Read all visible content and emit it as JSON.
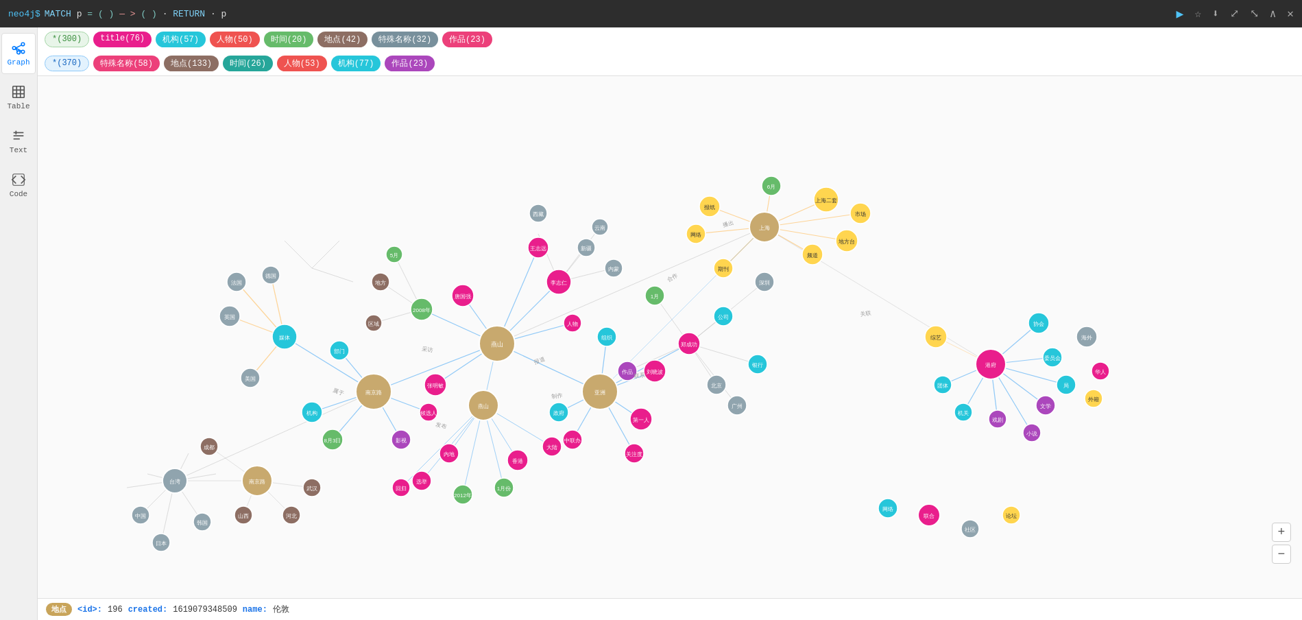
{
  "topbar": {
    "prompt": "neo4j$",
    "query": "MATCH p=()—>() RETURN p"
  },
  "sidebar": {
    "items": [
      {
        "label": "Graph",
        "icon": "graph-icon"
      },
      {
        "label": "Table",
        "icon": "table-icon"
      },
      {
        "label": "Text",
        "icon": "text-icon"
      },
      {
        "label": "Code",
        "icon": "code-icon"
      }
    ]
  },
  "tagbar": {
    "row1": [
      {
        "label": "*(300)",
        "class": "tag-star-300"
      },
      {
        "label": "title(76)",
        "class": "tag-title"
      },
      {
        "label": "机构(57)",
        "class": "tag-jigou"
      },
      {
        "label": "人物(50)",
        "class": "tag-renwu1"
      },
      {
        "label": "时间(20)",
        "class": "tag-shijian1"
      },
      {
        "label": "地点(42)",
        "class": "tag-didian1"
      },
      {
        "label": "特殊名称(32)",
        "class": "tag-teshu1"
      },
      {
        "label": "作品(23)",
        "class": "tag-zuopin1"
      }
    ],
    "row2": [
      {
        "label": "*(370)",
        "class": "tag-star-370"
      },
      {
        "label": "特殊名称(58)",
        "class": "tag-teshu2"
      },
      {
        "label": "地点(133)",
        "class": "tag-didian2"
      },
      {
        "label": "时间(26)",
        "class": "tag-shijian2"
      },
      {
        "label": "人物(53)",
        "class": "tag-renwu2"
      },
      {
        "label": "机构(77)",
        "class": "tag-jigou2"
      },
      {
        "label": "作品(23)",
        "class": "tag-zuopin2"
      }
    ]
  },
  "statusbar": {
    "node_type": "地点",
    "id_label": "<id>:",
    "id_val": "196",
    "created_label": "created:",
    "created_val": "1619079348509",
    "name_label": "name:",
    "name_val": "伦敦"
  },
  "zoom": {
    "in": "+",
    "out": "−"
  }
}
